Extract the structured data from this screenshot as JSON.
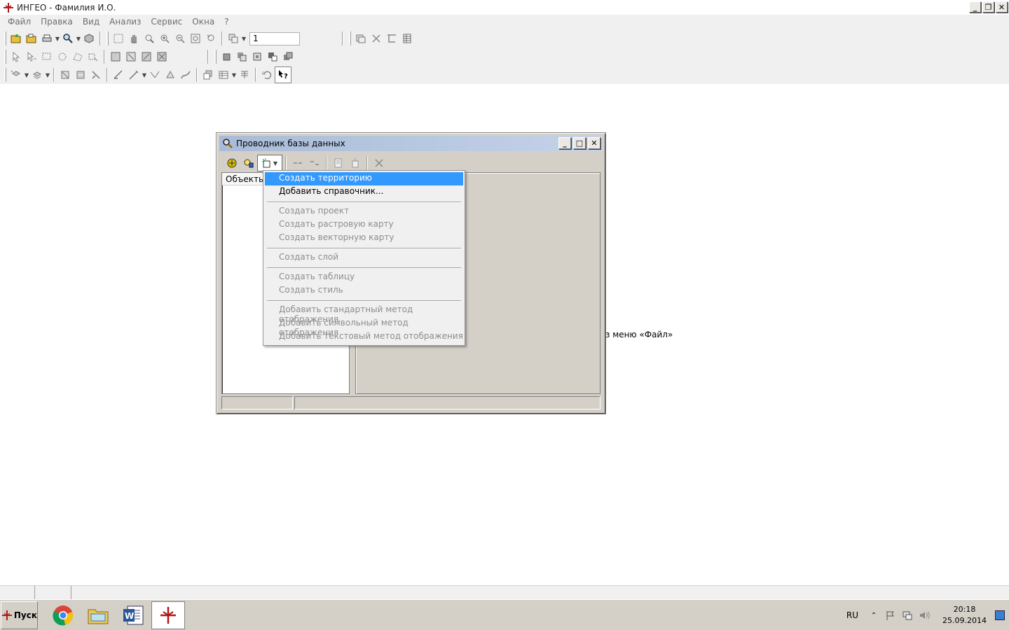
{
  "window": {
    "title": "ИНГЕО - Фамилия И.О.",
    "controls": [
      "_",
      "❐",
      "✕"
    ]
  },
  "menubar": [
    "Файл",
    "Правка",
    "Вид",
    "Анализ",
    "Сервис",
    "Окна",
    "?"
  ],
  "toolbar": {
    "scale_value": "1"
  },
  "workspace": {
    "hint": "з меню «Файл»"
  },
  "dialog": {
    "title": "Проводник базы данных",
    "tree_header": "Объекты"
  },
  "dropdown": {
    "items": [
      {
        "label": "Создать территорию",
        "state": "highlighted"
      },
      {
        "label": "Добавить справочник...",
        "state": "enabled"
      },
      {
        "sep": true
      },
      {
        "label": "Создать проект",
        "state": "disabled"
      },
      {
        "label": "Создать растровую карту",
        "state": "disabled"
      },
      {
        "label": "Создать векторную карту",
        "state": "disabled"
      },
      {
        "sep": true
      },
      {
        "label": "Создать слой",
        "state": "disabled"
      },
      {
        "sep": true
      },
      {
        "label": "Создать таблицу",
        "state": "disabled"
      },
      {
        "label": "Создать стиль",
        "state": "disabled"
      },
      {
        "sep": true
      },
      {
        "label": "Добавить стандартный метод отображения",
        "state": "disabled"
      },
      {
        "label": "Добавить символьный метод отображения",
        "state": "disabled"
      },
      {
        "label": "Добавить текстовый метод отображения",
        "state": "disabled"
      }
    ]
  },
  "taskbar": {
    "start_label": "Пуск",
    "lang": "RU",
    "time": "20:18",
    "date": "25.09.2014"
  },
  "colors": {
    "highlight": "#3399ff",
    "dialog_face": "#d4d0c8",
    "title_gradient": "#a9bbd8"
  }
}
